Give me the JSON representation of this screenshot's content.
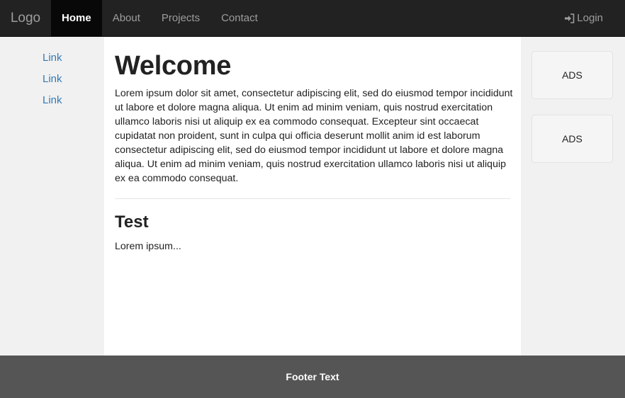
{
  "navbar": {
    "brand": "Logo",
    "items": [
      {
        "label": "Home",
        "active": true
      },
      {
        "label": "About",
        "active": false
      },
      {
        "label": "Projects",
        "active": false
      },
      {
        "label": "Contact",
        "active": false
      }
    ],
    "login_label": "Login",
    "login_icon": "log-in-icon"
  },
  "sidebar_left": {
    "links": [
      "Link",
      "Link",
      "Link"
    ]
  },
  "main": {
    "title": "Welcome",
    "paragraph": "Lorem ipsum dolor sit amet, consectetur adipiscing elit, sed do eiusmod tempor incididunt ut labore et dolore magna aliqua. Ut enim ad minim veniam, quis nostrud exercitation ullamco laboris nisi ut aliquip ex ea commodo consequat. Excepteur sint occaecat cupidatat non proident, sunt in culpa qui officia deserunt mollit anim id est laborum consectetur adipiscing elit, sed do eiusmod tempor incididunt ut labore et dolore magna aliqua. Ut enim ad minim veniam, quis nostrud exercitation ullamco laboris nisi ut aliquip ex ea commodo consequat.",
    "subtitle": "Test",
    "subparagraph": "Lorem ipsum..."
  },
  "sidebar_right": {
    "ads": [
      "ADS",
      "ADS"
    ]
  },
  "footer": {
    "text": "Footer Text"
  },
  "colors": {
    "navbar_bg": "#222222",
    "active_bg": "#080808",
    "link": "#337ab7",
    "footer_bg": "#555555",
    "side_bg": "#f1f1f1"
  }
}
